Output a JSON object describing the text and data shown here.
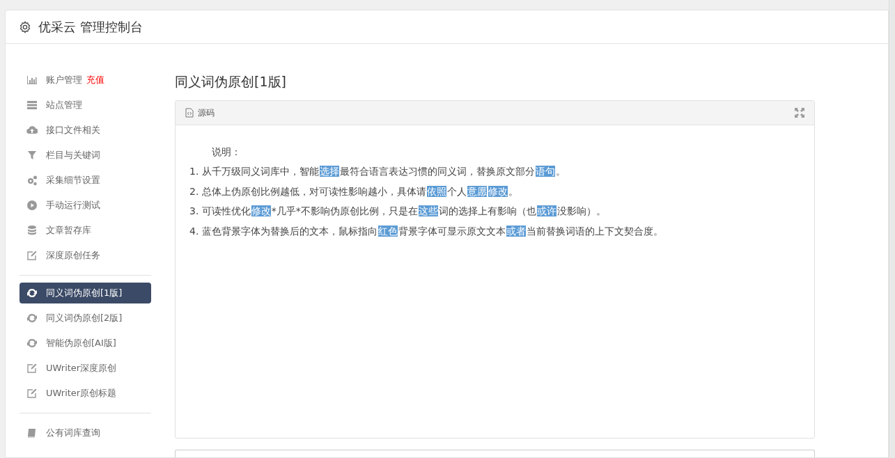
{
  "header": {
    "title": "优采云 管理控制台"
  },
  "sidebar": {
    "groups": [
      [
        {
          "label": "账户管理",
          "badge": "充值",
          "selected": false
        },
        {
          "label": "站点管理",
          "selected": false
        },
        {
          "label": "接口文件相关",
          "selected": false
        },
        {
          "label": "栏目与关键词",
          "selected": false
        },
        {
          "label": "采集细节设置",
          "selected": false
        },
        {
          "label": "手动运行测试",
          "selected": false
        },
        {
          "label": "文章暂存库",
          "selected": false
        },
        {
          "label": "深度原创任务",
          "selected": false
        }
      ],
      [
        {
          "label": "同义词伪原创[1版]",
          "selected": true
        },
        {
          "label": "同义词伪原创[2版]",
          "selected": false
        },
        {
          "label": "智能伪原创[AI版]",
          "selected": false
        },
        {
          "label": "UWriter深度原创",
          "selected": false
        },
        {
          "label": "UWriter原创标题",
          "selected": false
        }
      ],
      [
        {
          "label": "公有词库查询",
          "selected": false
        }
      ]
    ]
  },
  "main": {
    "title": "同义词伪原创[1版]",
    "editor": {
      "tab": "源码",
      "heading": "说明：",
      "lines": [
        [
          {
            "text": "1. 从千万级同义词库中，智能",
            "highlighted": false
          },
          {
            "text": "选择",
            "highlighted": true
          },
          {
            "text": "最符合语言表达习惯的同义词，替换原文部分",
            "highlighted": false
          },
          {
            "text": "语句",
            "highlighted": true
          },
          {
            "text": "。",
            "highlighted": false
          }
        ],
        [
          {
            "text": "2. 总体上伪原创比例越低，对可读性影响越小，具体请",
            "highlighted": false
          },
          {
            "text": "依照",
            "highlighted": true
          },
          {
            "text": "个人",
            "highlighted": false
          },
          {
            "text": "意愿",
            "highlighted": true
          },
          {
            "text": "修改",
            "highlighted": true
          },
          {
            "text": "。",
            "highlighted": false
          }
        ],
        [
          {
            "text": "3. 可读性优化",
            "highlighted": false
          },
          {
            "text": "修改",
            "highlighted": true
          },
          {
            "text": "*几乎*不影响伪原创比例，只是在",
            "highlighted": false
          },
          {
            "text": "这些",
            "highlighted": true
          },
          {
            "text": "词的选择上有影响（也",
            "highlighted": false
          },
          {
            "text": "或许",
            "highlighted": true
          },
          {
            "text": "没影响）。",
            "highlighted": false
          }
        ],
        [
          {
            "text": "4. 蓝色背景字体为替换后的文本，鼠标指向",
            "highlighted": false
          },
          {
            "text": "红色",
            "highlighted": true
          },
          {
            "text": "背景字体可显示原文文本",
            "highlighted": false
          },
          {
            "text": "或者",
            "highlighted": true
          },
          {
            "text": "当前替换词语的上下文契合度。",
            "highlighted": false
          }
        ]
      ]
    }
  }
}
